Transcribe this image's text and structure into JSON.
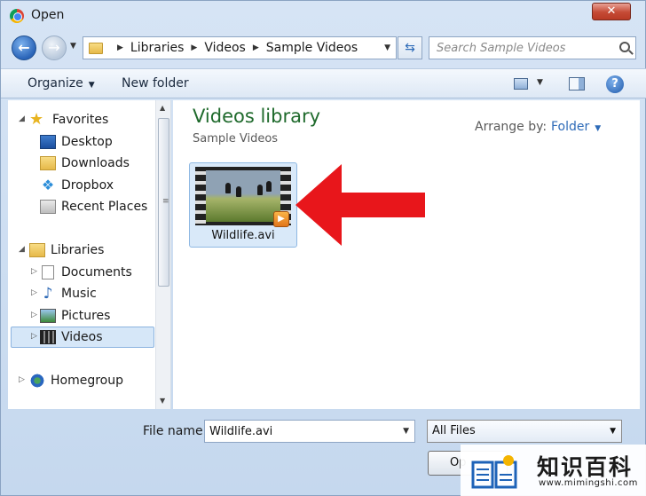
{
  "window": {
    "title": "Open",
    "close_label": "✕"
  },
  "nav": {
    "back_label": "←",
    "forward_label": "→",
    "address": [
      "Libraries",
      "Videos",
      "Sample Videos"
    ],
    "refresh_label": "⇆",
    "search_placeholder": "Search Sample Videos"
  },
  "toolbar": {
    "organize_label": "Organize",
    "new_folder_label": "New folder",
    "help_label": "?"
  },
  "sidebar": {
    "favorites": "Favorites",
    "favorites_items": [
      "Desktop",
      "Downloads",
      "Dropbox",
      "Recent Places"
    ],
    "libraries": "Libraries",
    "libraries_items": [
      "Documents",
      "Music",
      "Pictures",
      "Videos"
    ],
    "homegroup": "Homegroup",
    "selected": "Videos"
  },
  "content": {
    "title": "Videos library",
    "subtitle": "Sample Videos",
    "arrange_label": "Arrange by:",
    "arrange_value": "Folder",
    "files": [
      {
        "name": "Wildlife.avi",
        "type": "video"
      }
    ]
  },
  "bottom": {
    "filename_label": "File name:",
    "filename_value": "Wildlife.avi",
    "filter_value": "All Files",
    "open_label": "Op"
  },
  "watermark": {
    "chinese": "知识百科",
    "url": "www.mimingshi.com"
  },
  "colors": {
    "accent": "#2e6bb8",
    "library_title": "#1f6a2c",
    "arrow": "#e8161b"
  }
}
